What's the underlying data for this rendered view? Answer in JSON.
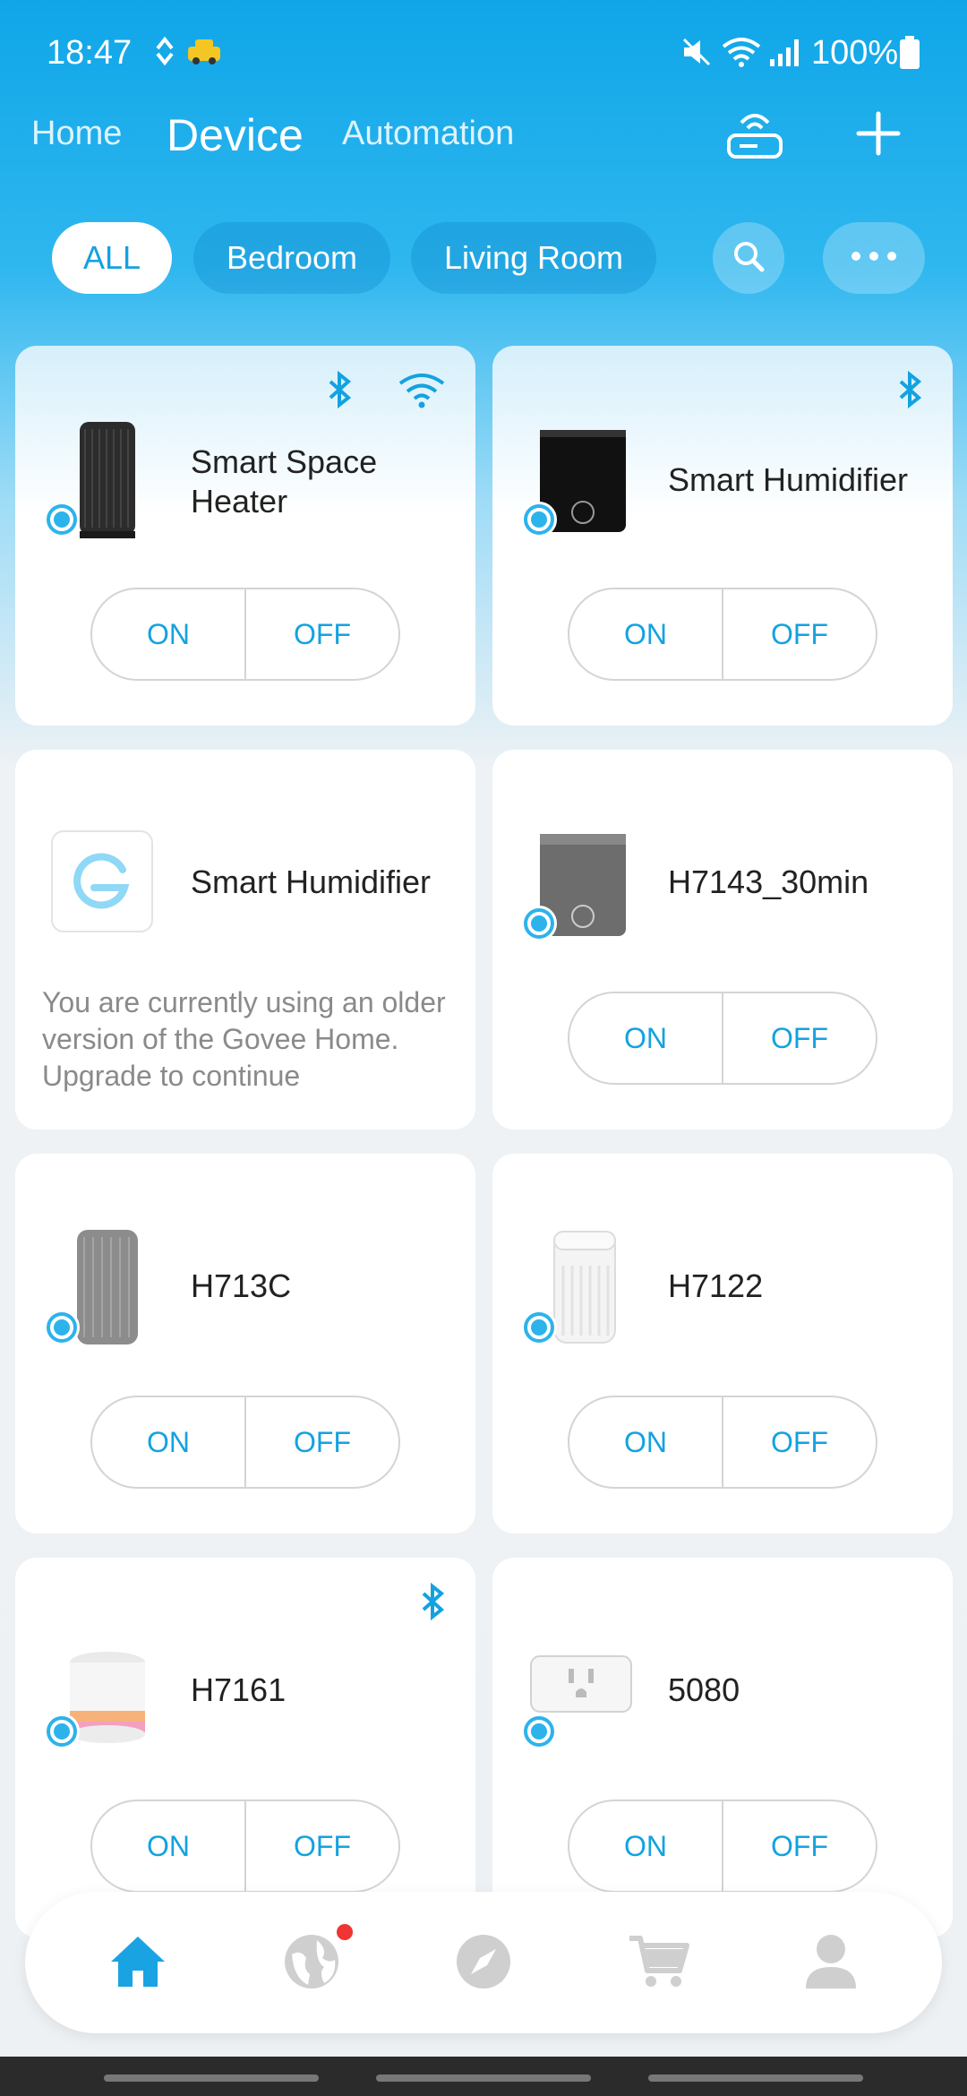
{
  "status": {
    "time": "18:47",
    "battery": "100%"
  },
  "nav": {
    "home": "Home",
    "device": "Device",
    "automation": "Automation"
  },
  "filters": {
    "all": "ALL",
    "bedroom": "Bedroom",
    "living_room": "Living Room"
  },
  "control": {
    "on": "ON",
    "off": "OFF"
  },
  "devices": [
    {
      "name": "Smart Space Heater",
      "bluetooth": true,
      "wifi": true
    },
    {
      "name": "Smart Humidifier",
      "bluetooth": true,
      "wifi": false
    },
    {
      "name": "Smart Humidifier",
      "note": "You are currently using an older version of the Govee Home. Upgrade to continue"
    },
    {
      "name": "H7143_30min"
    },
    {
      "name": "H713C"
    },
    {
      "name": "H7122"
    },
    {
      "name": "H7161",
      "bluetooth": true
    },
    {
      "name": "5080"
    }
  ],
  "colors": {
    "accent": "#13a2e0",
    "header_blue": "#0fa6e8",
    "notification_dot": "#f03434"
  },
  "bottom_nav": [
    "home-icon",
    "globe-icon",
    "compass-icon",
    "cart-icon",
    "profile-icon"
  ]
}
